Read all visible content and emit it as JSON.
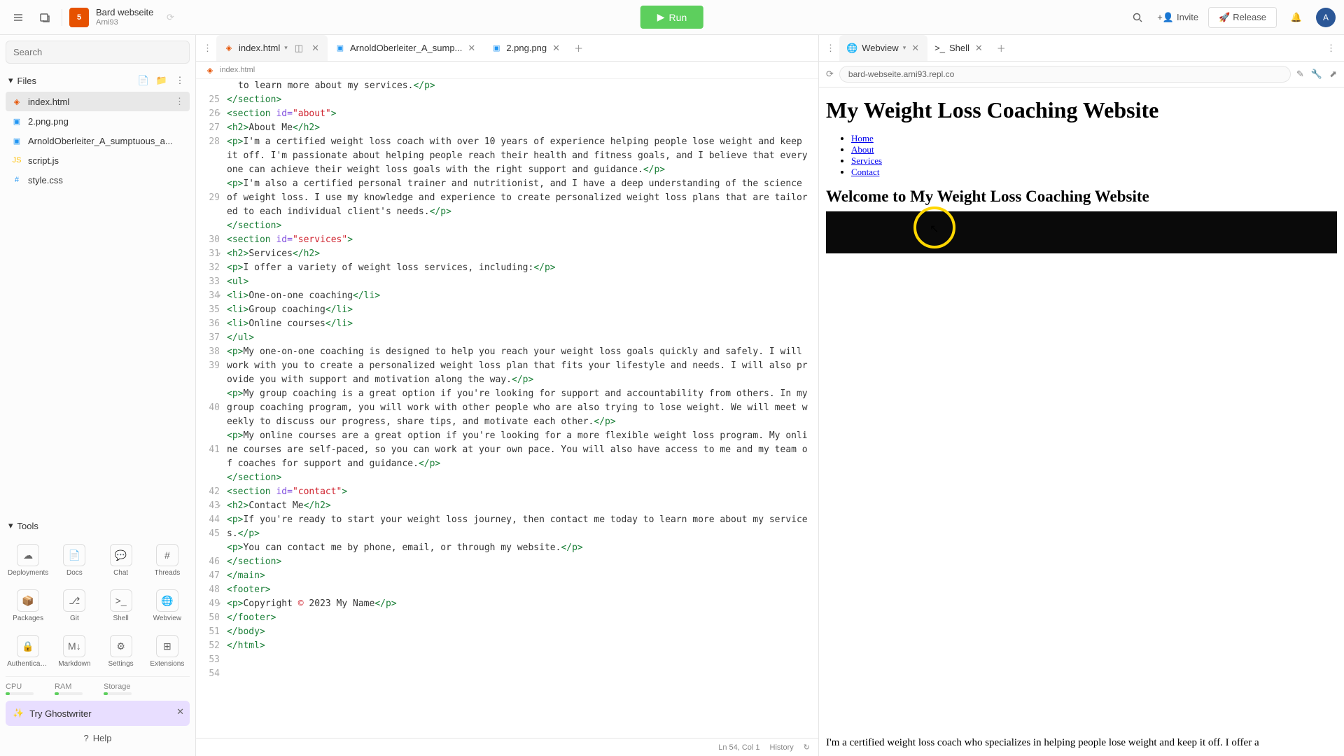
{
  "header": {
    "project_name": "Bard webseite",
    "project_user": "Arni93",
    "run_label": "Run",
    "invite_label": "Invite",
    "release_label": "Release"
  },
  "sidebar": {
    "search_placeholder": "Search",
    "files_label": "Files",
    "files": [
      {
        "name": "index.html",
        "type": "html",
        "selected": true
      },
      {
        "name": "2.png.png",
        "type": "img"
      },
      {
        "name": "ArnoldOberleiter_A_sumptuous_a...",
        "type": "img"
      },
      {
        "name": "script.js",
        "type": "js"
      },
      {
        "name": "style.css",
        "type": "css"
      }
    ],
    "tools_label": "Tools",
    "tools": [
      {
        "label": "Deployments",
        "glyph": "☁"
      },
      {
        "label": "Docs",
        "glyph": "📄"
      },
      {
        "label": "Chat",
        "glyph": "💬"
      },
      {
        "label": "Threads",
        "glyph": "#"
      },
      {
        "label": "Packages",
        "glyph": "📦"
      },
      {
        "label": "Git",
        "glyph": "⎇"
      },
      {
        "label": "Shell",
        "glyph": ">_"
      },
      {
        "label": "Webview",
        "glyph": "🌐"
      },
      {
        "label": "Authenticati...",
        "glyph": "🔒"
      },
      {
        "label": "Markdown",
        "glyph": "M↓"
      },
      {
        "label": "Settings",
        "glyph": "⚙"
      },
      {
        "label": "Extensions",
        "glyph": "⊞"
      }
    ],
    "resources": [
      {
        "label": "CPU"
      },
      {
        "label": "RAM"
      },
      {
        "label": "Storage"
      }
    ],
    "ghostwriter_label": "Try Ghostwriter",
    "help_label": "Help"
  },
  "editor": {
    "tabs": [
      {
        "label": "index.html",
        "active": true,
        "type": "html",
        "split": true
      },
      {
        "label": "ArnoldOberleiter_A_sump...",
        "type": "img"
      },
      {
        "label": "2.png.png",
        "type": "img"
      }
    ],
    "breadcrumb": "index.html",
    "status_pos": "Ln 54, Col 1",
    "status_history": "History",
    "code_frag_top": "to learn more about my services.",
    "lines": {
      "l25": {
        "tag": "</section>"
      },
      "l26": {
        "open": "<section ",
        "attr": "id=",
        "str": "\"about\"",
        "close": ">"
      },
      "l27": {
        "open": "<h2>",
        "text": "About Me",
        "close": "</h2>"
      },
      "l28": {
        "open": "<p>",
        "text": "I'm a certified weight loss coach with over 10 years of experience helping people lose weight and keep it off. I'm passionate about helping people reach their health and fitness goals, and I believe that everyone can achieve their weight loss goals with the right support and guidance.",
        "close": "</p>"
      },
      "l29": {
        "open": "<p>",
        "text": "I'm also a certified personal trainer and nutritionist, and I have a deep understanding of the science of weight loss. I use my knowledge and experience to create personalized weight loss plans that are tailored to each individual client's needs.",
        "close": "</p>"
      },
      "l30": {
        "tag": "</section>"
      },
      "l31": {
        "open": "<section ",
        "attr": "id=",
        "str": "\"services\"",
        "close": ">"
      },
      "l32": {
        "open": "<h2>",
        "text": "Services",
        "close": "</h2>"
      },
      "l33": {
        "open": "<p>",
        "text": "I offer a variety of weight loss services, including:",
        "close": "</p>"
      },
      "l34": {
        "tag": "<ul>"
      },
      "l35": {
        "open": "<li>",
        "text": "One-on-one coaching",
        "close": "</li>"
      },
      "l36": {
        "open": "<li>",
        "text": "Group coaching",
        "close": "</li>"
      },
      "l37": {
        "open": "<li>",
        "text": "Online courses",
        "close": "</li>"
      },
      "l38": {
        "tag": "</ul>"
      },
      "l39": {
        "open": "<p>",
        "text": "My one-on-one coaching is designed to help you reach your weight loss goals quickly and safely. I will work with you to create a personalized weight loss plan that fits your lifestyle and needs. I will also provide you with support and motivation along the way.",
        "close": "</p>"
      },
      "l40": {
        "open": "<p>",
        "text": "My group coaching is a great option if you're looking for support and accountability from others. In my group coaching program, you will work with other people who are also trying to lose weight. We will meet weekly to discuss our progress, share tips, and motivate each other.",
        "close": "</p>"
      },
      "l41": {
        "open": "<p>",
        "text": "My online courses are a great option if you're looking for a more flexible weight loss program. My online courses are self-paced, so you can work at your own pace. You will also have access to me and my team of coaches for support and guidance.",
        "close": "</p>"
      },
      "l42": {
        "tag": "</section>"
      },
      "l43": {
        "open": "<section ",
        "attr": "id=",
        "str": "\"contact\"",
        "close": ">"
      },
      "l44": {
        "open": "<h2>",
        "text": "Contact Me",
        "close": "</h2>"
      },
      "l45": {
        "open": "<p>",
        "text": "If you're ready to start your weight loss journey, then contact me today to learn more about my services.",
        "close": "</p>"
      },
      "l46": {
        "open": "<p>",
        "text": "You can contact me by phone, email, or through my website.",
        "close": "</p>"
      },
      "l47": {
        "tag": "</section>"
      },
      "l48": {
        "tag": "</main>"
      },
      "l49": {
        "tag": "<footer>"
      },
      "l50": {
        "open": "<p>",
        "text1": "Copyright ",
        "ent": "&copy;",
        "text2": " 2023 My Name",
        "close": "</p>"
      },
      "l51": {
        "tag": "</footer>"
      },
      "l52": {
        "tag": "</body>"
      },
      "l53": {
        "tag": "</html>"
      }
    }
  },
  "preview": {
    "tabs": [
      {
        "label": "Webview",
        "active": true,
        "dropdown": true
      },
      {
        "label": "Shell"
      }
    ],
    "url": "bard-webseite.arni93.repl.co",
    "h1": "My Weight Loss Coaching Website",
    "nav": [
      "Home",
      "About",
      "Services",
      "Contact"
    ],
    "h2": "Welcome to My Weight Loss Coaching Website",
    "bottom_text": "I'm a certified weight loss coach who specializes in helping people lose weight and keep it off. I offer a"
  }
}
